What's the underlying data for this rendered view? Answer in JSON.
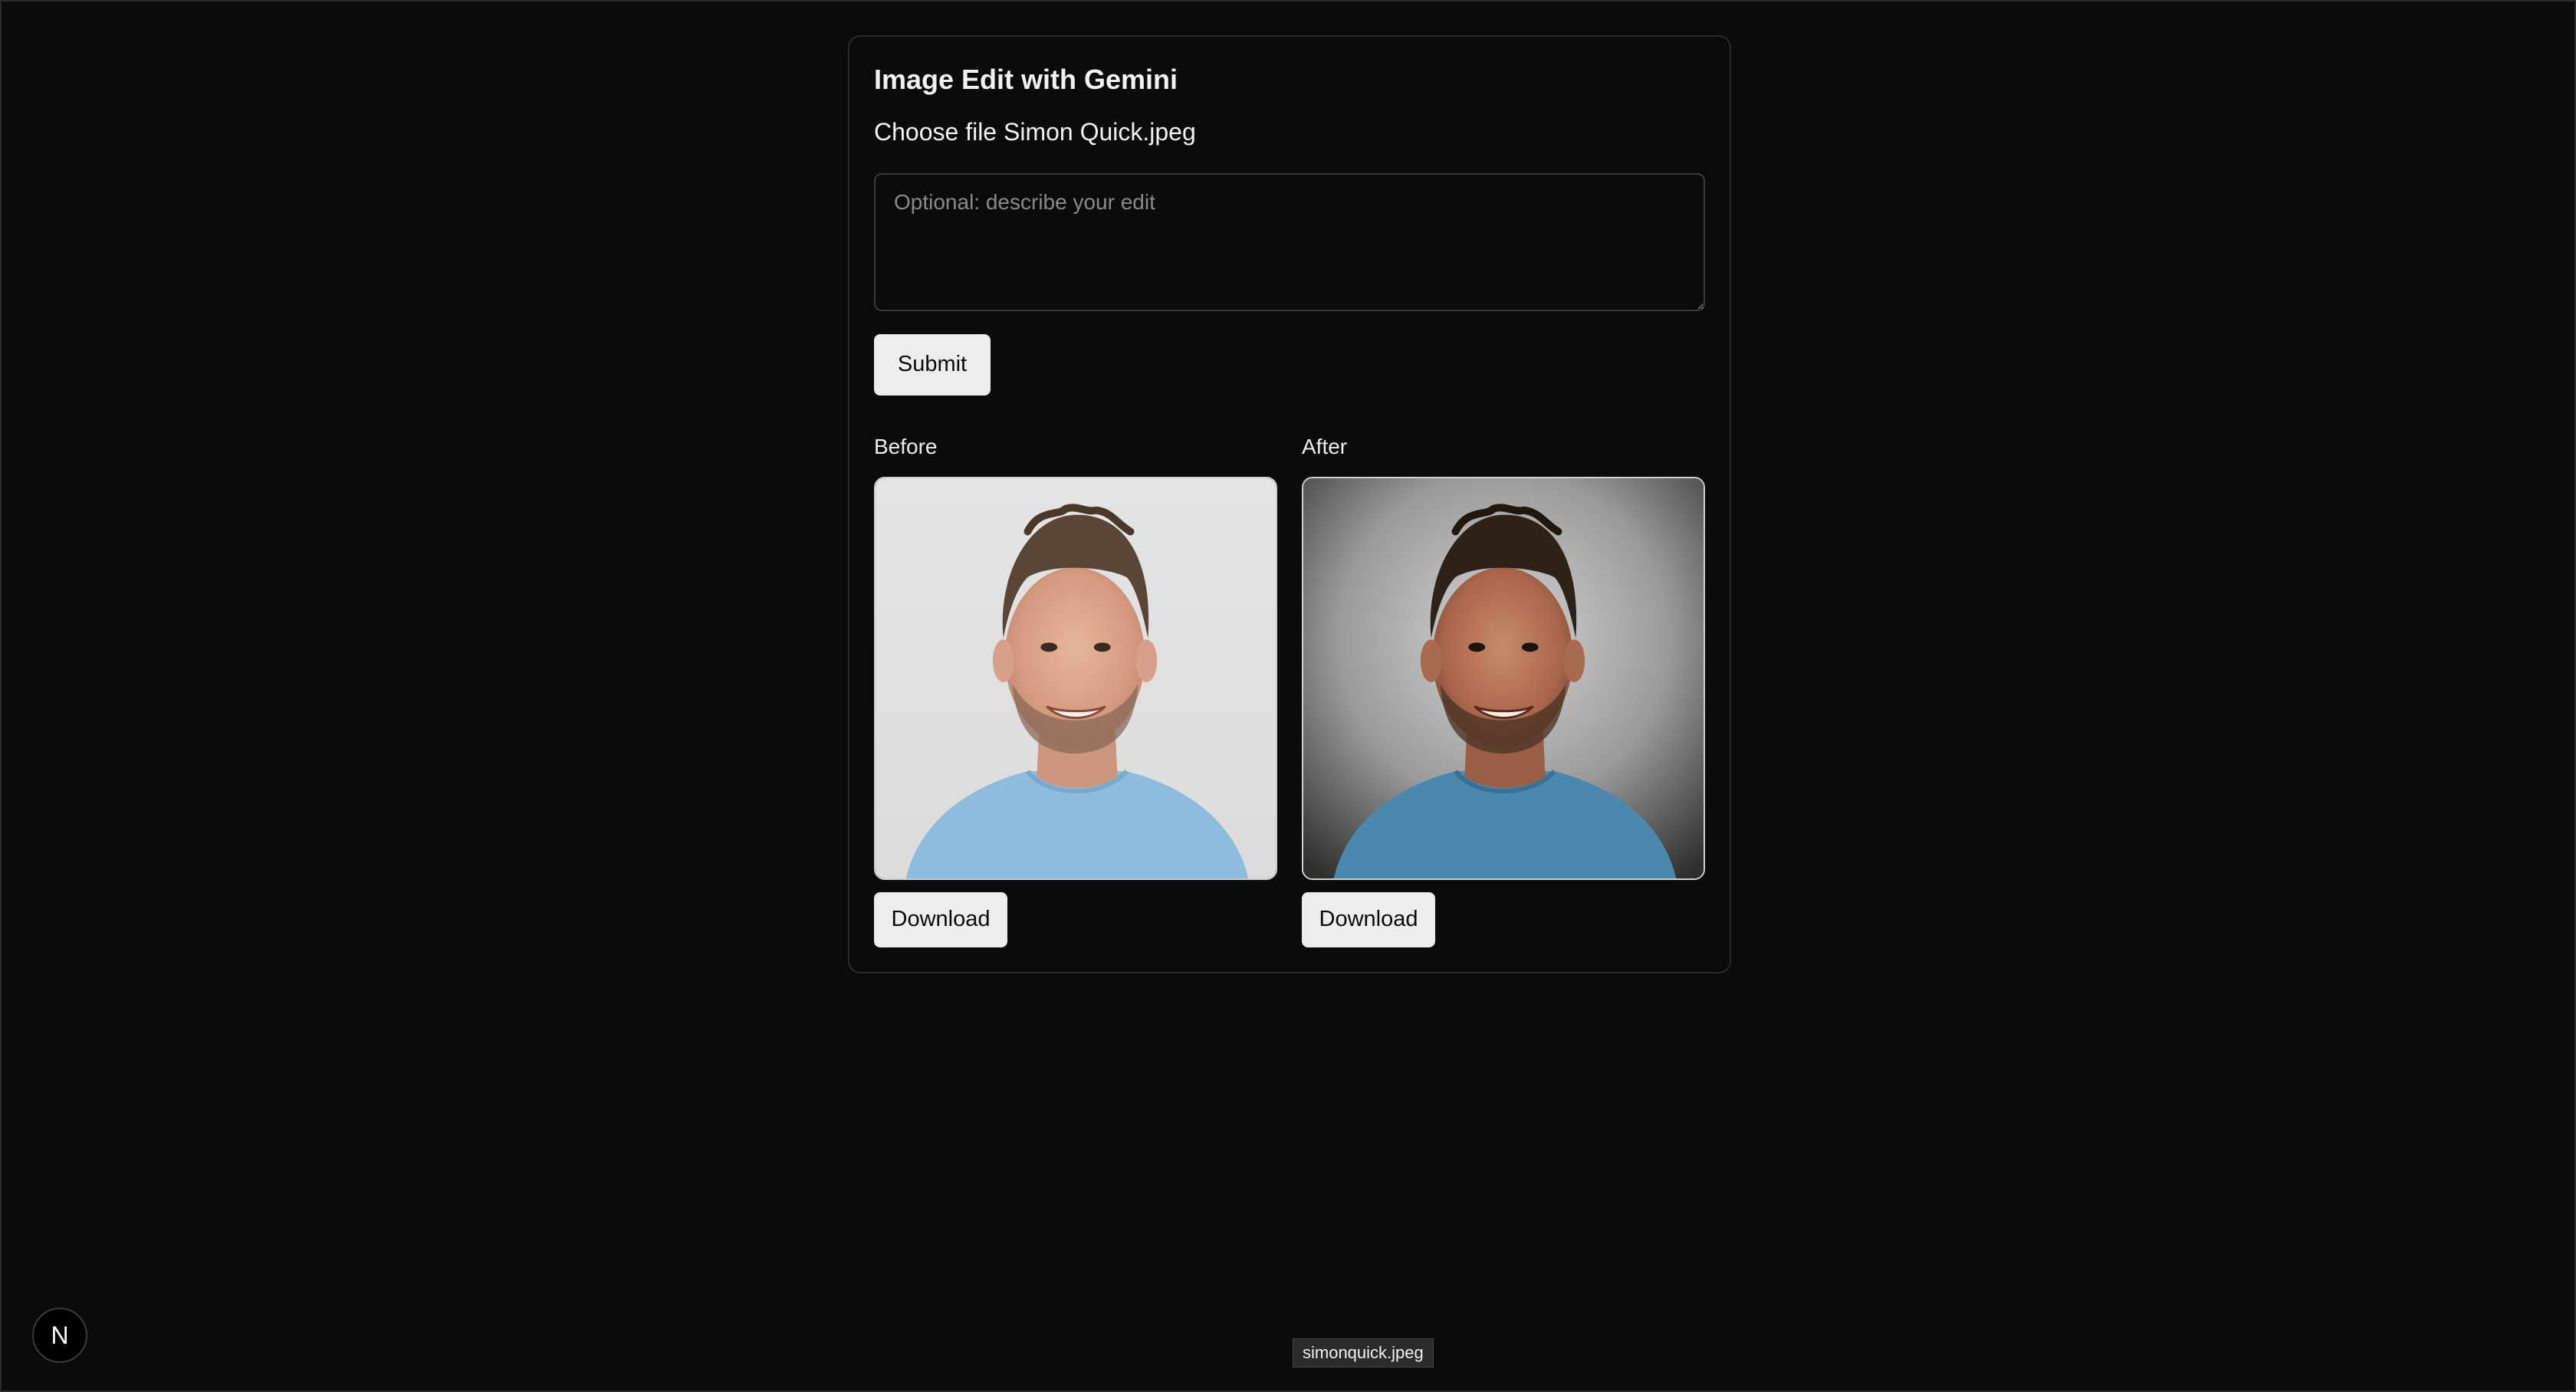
{
  "app": {
    "title": "Image Edit with Gemini"
  },
  "file_input": {
    "choose_label": "Choose file",
    "file_name": "Simon Quick.jpeg"
  },
  "prompt": {
    "placeholder": "Optional: describe your edit",
    "value": ""
  },
  "actions": {
    "submit_label": "Submit"
  },
  "before": {
    "label": "Before",
    "download_label": "Download"
  },
  "after": {
    "label": "After",
    "download_label": "Download"
  },
  "dev_badge": {
    "letter": "N"
  },
  "tooltip": {
    "text": "simonquick.jpeg"
  },
  "colors": {
    "background": "#0b0b0b",
    "button_bg": "#ededed",
    "before_bg": "#e2e2e2",
    "shirt": "#8fbcdc",
    "after_shirt": "#4a88ad"
  }
}
